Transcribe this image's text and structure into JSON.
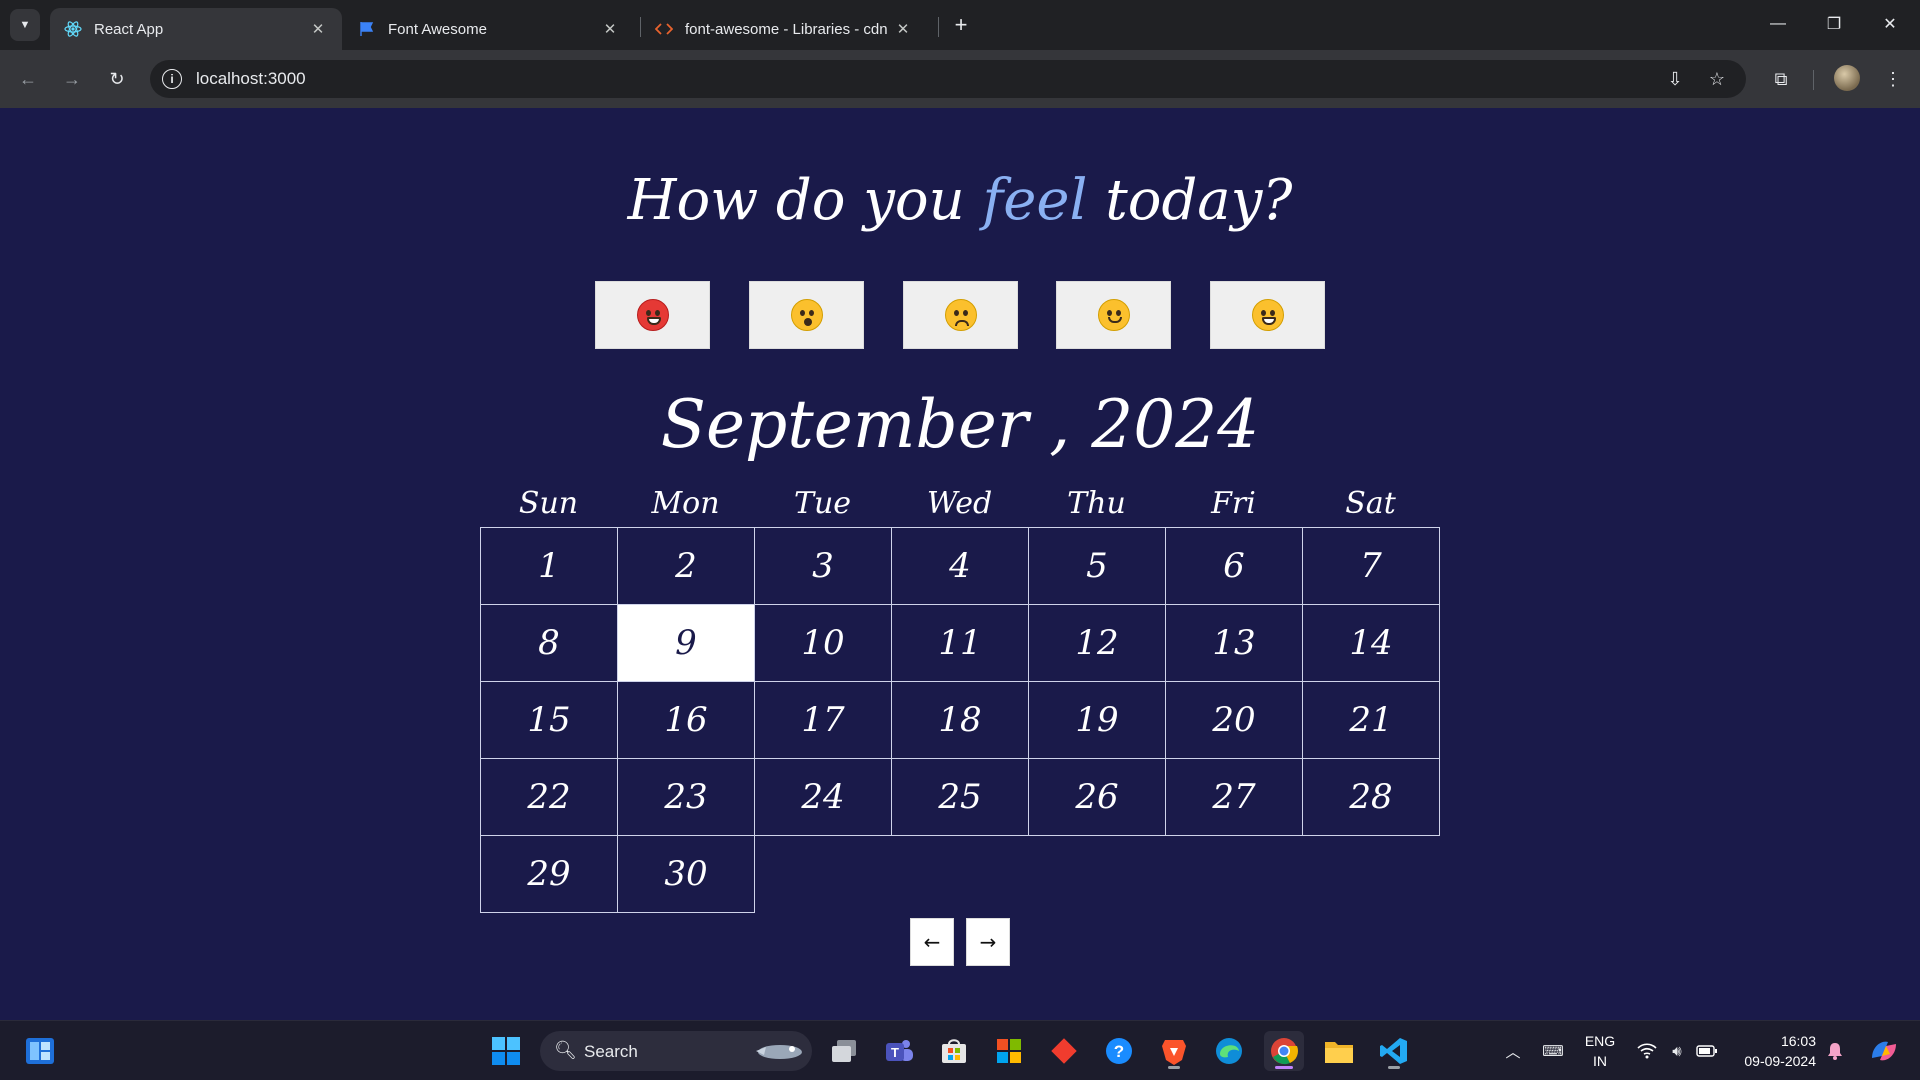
{
  "browser": {
    "tabs": [
      {
        "title": "React App",
        "active": true,
        "icon": "react-icon"
      },
      {
        "title": "Font Awesome",
        "active": false,
        "icon": "flag-icon"
      },
      {
        "title": "font-awesome - Libraries - cdnjs",
        "active": false,
        "icon": "code-icon"
      }
    ],
    "address": "localhost:3000",
    "icons": [
      "back-icon",
      "forward-icon",
      "reload-icon",
      "info-icon",
      "install-icon",
      "star-icon",
      "extensions-icon",
      "avatar",
      "menu-icon"
    ]
  },
  "page": {
    "headline": {
      "before": "How do you ",
      "accent": "feel",
      "after": " today?"
    },
    "accent_color": "#8ab0f2",
    "background_color": "#1a1a4a",
    "moods": [
      {
        "name": "angry",
        "icon": "angry-face-icon"
      },
      {
        "name": "crying",
        "icon": "crying-face-icon"
      },
      {
        "name": "sad",
        "icon": "disappointed-face-icon"
      },
      {
        "name": "happy",
        "icon": "smiling-face-icon"
      },
      {
        "name": "very-happy",
        "icon": "grinning-face-icon"
      }
    ],
    "month_title": "September , 2024",
    "weekdays": [
      "Sun",
      "Mon",
      "Tue",
      "Wed",
      "Thu",
      "Fri",
      "Sat"
    ],
    "days": [
      "1",
      "2",
      "3",
      "4",
      "5",
      "6",
      "7",
      "8",
      "9",
      "10",
      "11",
      "12",
      "13",
      "14",
      "15",
      "16",
      "17",
      "18",
      "19",
      "20",
      "21",
      "22",
      "23",
      "24",
      "25",
      "26",
      "27",
      "28",
      "29",
      "30"
    ],
    "first_weekday_index": 0,
    "today": "9",
    "prev_label": "←",
    "next_label": "→"
  },
  "taskbar": {
    "search_label": "Search",
    "apps": [
      "widgets-icon",
      "windows-start-icon",
      "task-view-icon",
      "teams-icon",
      "store-icon",
      "office-icon",
      "git-icon",
      "help-icon",
      "brave-icon",
      "edge-icon",
      "chrome-icon",
      "file-explorer-icon",
      "vscode-icon"
    ],
    "lang_line1": "ENG",
    "lang_line2": "IN",
    "time": "16:03",
    "date": "09-09-2024"
  }
}
